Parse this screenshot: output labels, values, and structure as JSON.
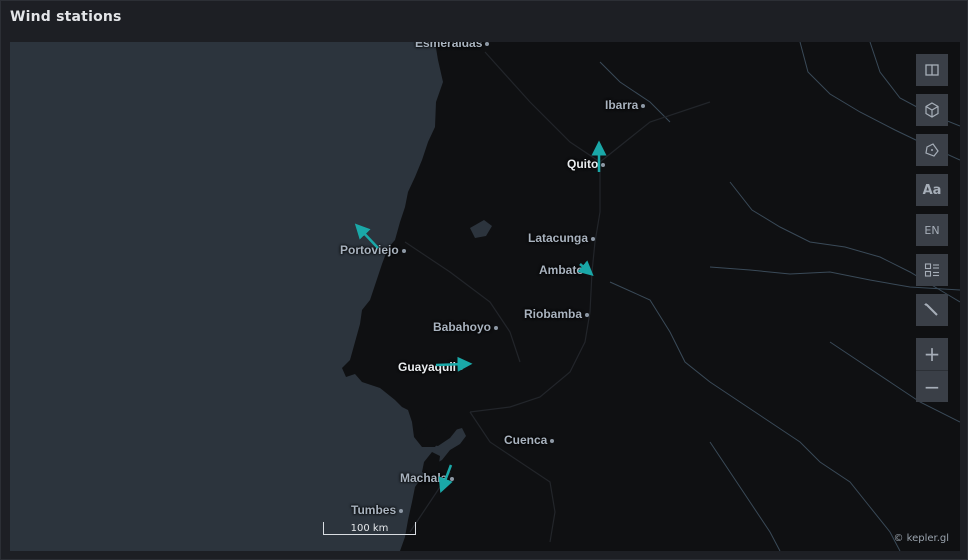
{
  "panel": {
    "title": "Wind stations"
  },
  "map": {
    "ocean_color": "#2c343d",
    "land_color": "#0f1012",
    "arrow_color": "#1aa8a8",
    "cities": [
      {
        "id": "esmeraldas",
        "name": "Esmeraldas",
        "major": false
      },
      {
        "id": "ibarra",
        "name": "Ibarra",
        "major": false
      },
      {
        "id": "quito",
        "name": "Quito",
        "major": true
      },
      {
        "id": "latacunga",
        "name": "Latacunga",
        "major": false
      },
      {
        "id": "portoviejo",
        "name": "Portoviejo",
        "major": false
      },
      {
        "id": "ambato",
        "name": "Ambato",
        "major": false
      },
      {
        "id": "riobamba",
        "name": "Riobamba",
        "major": false
      },
      {
        "id": "babahoyo",
        "name": "Babahoyo",
        "major": false
      },
      {
        "id": "guayaquil",
        "name": "Guayaquil",
        "major": true
      },
      {
        "id": "cuenca",
        "name": "Cuenca",
        "major": false
      },
      {
        "id": "machala",
        "name": "Machala",
        "major": false
      },
      {
        "id": "tumbes",
        "name": "Tumbes",
        "major": false
      }
    ],
    "scale_bar": {
      "label": "100 km"
    },
    "attribution": "© kepler.gl"
  },
  "controls": {
    "split_map": "split-map-icon",
    "view_3d": "cube-icon",
    "draw": "polygon-draw-icon",
    "labels": "Aa",
    "locale": "EN",
    "legend": "legend-icon",
    "editor": "wand-icon",
    "zoom_in": "+",
    "zoom_out": "−"
  }
}
